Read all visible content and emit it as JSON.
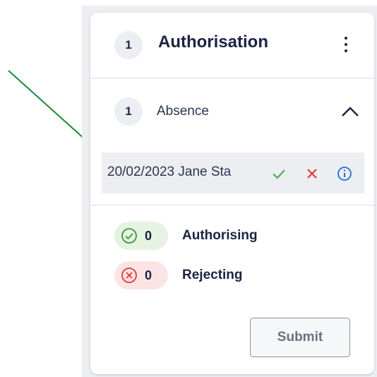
{
  "authorisation": {
    "count": "1",
    "title": "Authorisation"
  },
  "absence": {
    "count": "1",
    "label": "Absence"
  },
  "request": {
    "text": "20/02/2023 Jane Sta"
  },
  "stats": {
    "authorising_count": "0",
    "authorising_label": "Authorising",
    "rejecting_count": "0",
    "rejecting_label": "Rejecting"
  },
  "submit_label": "Submit",
  "colors": {
    "approve": "#4caf50",
    "reject": "#e53935",
    "info": "#1e6fd9",
    "arrow": "#1a8a3c",
    "authorising_bg": "#e6f2e2",
    "rejecting_bg": "#fbe4e4"
  },
  "icons": [
    "kebab-menu-icon",
    "chevron-up-icon",
    "check-icon",
    "close-icon",
    "info-icon",
    "check-circle-icon",
    "x-circle-icon",
    "annotation-arrow"
  ]
}
